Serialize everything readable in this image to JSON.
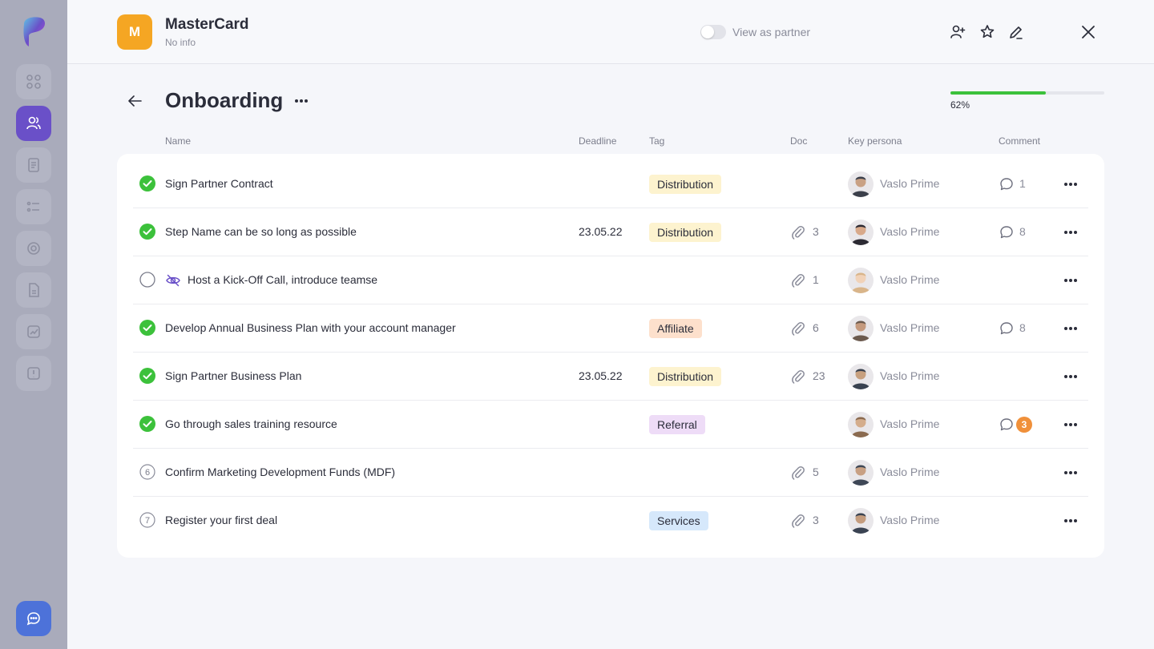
{
  "header": {
    "company_initial": "M",
    "company_name": "MasterCard",
    "company_sub": "No info",
    "view_as_partner_label": "View as partner",
    "accent": "#f5a623"
  },
  "page": {
    "title": "Onboarding",
    "progress_label": "62%",
    "progress_value": 0.62
  },
  "columns": {
    "name": "Name",
    "deadline": "Deadline",
    "tag": "Tag",
    "doc": "Doc",
    "persona": "Key persona",
    "comment": "Comment"
  },
  "rows": [
    {
      "status": "done",
      "name": "Sign Partner Contract",
      "deadline": "",
      "tag": "Distribution",
      "tag_color": "#fdf3cf",
      "doc": "",
      "persona": "Vaslo Prime",
      "comments": "1",
      "comment_badge": false
    },
    {
      "status": "done",
      "name": "Step Name can be so long as possible",
      "deadline": "23.05.22",
      "tag": "Distribution",
      "tag_color": "#fdf3cf",
      "doc": "3",
      "persona": "Vaslo Prime",
      "comments": "8",
      "comment_badge": false
    },
    {
      "status": "empty",
      "hidden": true,
      "name": "Host a Kick-Off Call, introduce teamse",
      "deadline": "",
      "tag": "",
      "tag_color": "",
      "doc": "1",
      "persona": "Vaslo Prime",
      "comments": "",
      "comment_badge": false
    },
    {
      "status": "done",
      "name": "Develop Annual Business Plan with your account manager",
      "deadline": "",
      "tag": "Affiliate",
      "tag_color": "#fde0cc",
      "doc": "6",
      "persona": "Vaslo Prime",
      "comments": "8",
      "comment_badge": false
    },
    {
      "status": "done",
      "name": "Sign Partner Business Plan",
      "deadline": "23.05.22",
      "tag": "Distribution",
      "tag_color": "#fdf3cf",
      "doc": "23",
      "persona": "Vaslo Prime",
      "comments": "",
      "comment_badge": false
    },
    {
      "status": "done",
      "name": "Go through sales training resource",
      "deadline": "",
      "tag": "Referral",
      "tag_color": "#eedcf7",
      "doc": "",
      "persona": "Vaslo Prime",
      "comments": "3",
      "comment_badge": true
    },
    {
      "status": "number",
      "step": "6",
      "name": "Confirm Marketing Development Funds (MDF)",
      "deadline": "",
      "tag": "",
      "tag_color": "",
      "doc": "5",
      "persona": "Vaslo Prime",
      "comments": "",
      "comment_badge": false
    },
    {
      "status": "number",
      "step": "7",
      "name": "Register your first deal",
      "deadline": "",
      "tag": "Services",
      "tag_color": "#d6e8fb",
      "doc": "3",
      "persona": "Vaslo Prime",
      "comments": "",
      "comment_badge": false
    }
  ],
  "icons": {
    "sidebar": [
      "logo-icon",
      "grid-icon",
      "users-icon",
      "document-icon",
      "checklist-icon",
      "target-icon",
      "file-icon",
      "chart-icon",
      "badge-icon",
      "chat-icon"
    ],
    "header": [
      "add-user-icon",
      "star-icon",
      "edit-icon",
      "close-icon"
    ]
  },
  "colors": {
    "done_green": "#3cc13b",
    "sidebar_active": "#6a50c8",
    "chat_blue": "#4d72d9",
    "badge_orange": "#f0903a"
  }
}
